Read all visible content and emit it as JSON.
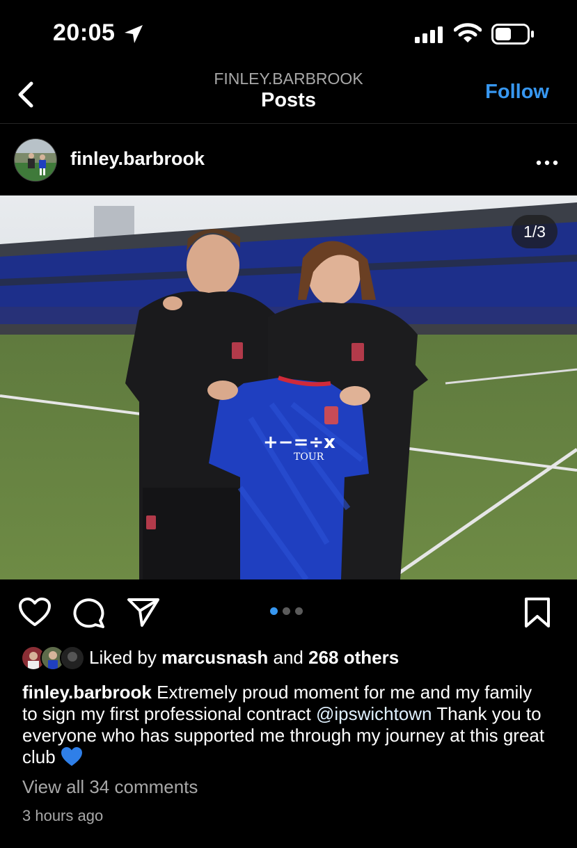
{
  "status_bar": {
    "time": "20:05",
    "battery_level": 0.45
  },
  "header": {
    "username": "FINLEY.BARBROOK",
    "title": "Posts",
    "follow_label": "Follow"
  },
  "post": {
    "username": "finley.barbrook",
    "image_counter": "1/3",
    "carousel": {
      "count": 3,
      "active_index": 0
    },
    "jersey_text": "TOUR",
    "jersey_symbols": "+−=÷x",
    "likes": {
      "prefix": "Liked by",
      "first_user": "marcusnash",
      "and": "and",
      "others": "268 others"
    },
    "caption": {
      "username": "finley.barbrook",
      "text_before": "Extremely proud moment for me and my family to sign my first professional contract",
      "mention": "@ipswichtown",
      "text_after": "Thank you to everyone who has supported me through my journey at this great club",
      "emoji": "💙"
    },
    "view_comments": "View all 34 comments",
    "time_ago": "3 hours ago"
  },
  "colors": {
    "accent": "#3797f0",
    "background": "#000000",
    "muted": "#a8a8a8",
    "kit_blue": "#1f3fc0"
  },
  "icons": [
    "location-arrow-icon",
    "signal-icon",
    "wifi-icon",
    "battery-icon",
    "back-chevron-icon",
    "more-options-icon",
    "heart-icon",
    "comment-icon",
    "share-icon",
    "bookmark-icon",
    "blue-heart-emoji"
  ]
}
